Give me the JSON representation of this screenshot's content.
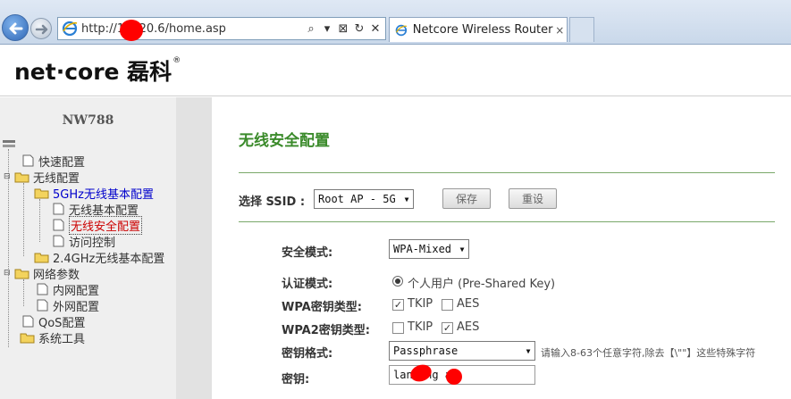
{
  "browser": {
    "url": "http://1  4.20.6/home.asp",
    "tab_title": "Netcore Wireless Router",
    "tab_close": "×",
    "tools": [
      "⌕",
      "▾",
      "⊠",
      "↻",
      "✕"
    ]
  },
  "brand": {
    "logo_text": "net·core 磊科",
    "reg_mark": "®"
  },
  "sidebar": {
    "device_title": "NW788",
    "items": [
      {
        "label": "快速配置"
      },
      {
        "label": "无线配置"
      },
      {
        "label": "5GHz无线基本配置"
      },
      {
        "label": "无线基本配置"
      },
      {
        "label": "无线安全配置"
      },
      {
        "label": "访问控制"
      },
      {
        "label": "2.4GHz无线基本配置"
      },
      {
        "label": "网络参数"
      },
      {
        "label": "内网配置"
      },
      {
        "label": "外网配置"
      },
      {
        "label": "QoS配置"
      },
      {
        "label": "系统工具"
      }
    ]
  },
  "main": {
    "page_title": "无线安全配置",
    "ssid_label": "选择 SSID :",
    "ssid_value": "Root AP - 5G",
    "save_button": "保存",
    "reset_button": "重设",
    "security_mode_label": "安全模式:",
    "security_mode_value": "WPA-Mixed",
    "auth_mode_label": "认证模式:",
    "auth_mode_value": "个人用户 (Pre-Shared Key)",
    "wpa_cipher_label": "WPA密钥类型:",
    "wpa2_cipher_label": "WPA2密钥类型:",
    "tkip_label": "TKIP",
    "aes_label": "AES",
    "wpa_tkip_checked": true,
    "wpa_aes_checked": false,
    "wpa2_tkip_checked": false,
    "wpa2_aes_checked": true,
    "key_format_label": "密钥格式:",
    "key_format_value": "Passphrase",
    "key_format_hint": "请输入8-63个任意字符,除去【\\\"\"】这些特殊字符",
    "key_label": "密钥:",
    "key_value": "lan   ang   ao"
  },
  "colors": {
    "title_green": "#3a8a2a",
    "active_link": "#0000cc",
    "current_item": "#cc0000",
    "redaction": "#ff0000"
  }
}
